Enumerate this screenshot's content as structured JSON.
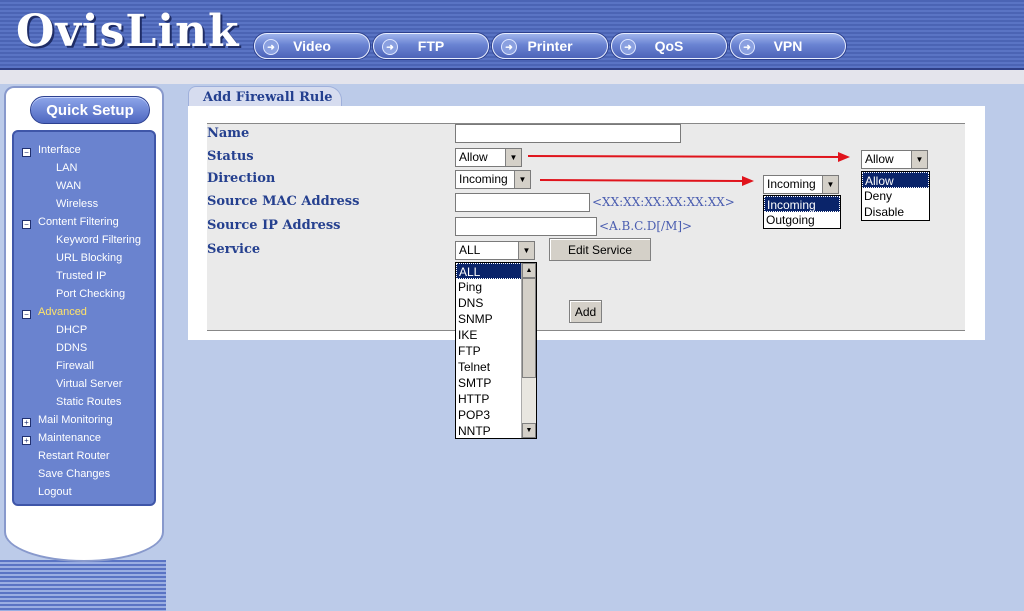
{
  "header": {
    "logo": "OvisLink",
    "nav": [
      {
        "label": "Video"
      },
      {
        "label": "FTP"
      },
      {
        "label": "Printer"
      },
      {
        "label": "QoS"
      },
      {
        "label": "VPN"
      }
    ]
  },
  "sidebar": {
    "quick_setup": "Quick Setup",
    "items": [
      {
        "label": "Interface",
        "toggle": "−"
      },
      {
        "label": "LAN"
      },
      {
        "label": "WAN"
      },
      {
        "label": "Wireless"
      },
      {
        "label": "Content Filtering",
        "toggle": "−"
      },
      {
        "label": "Keyword Filtering"
      },
      {
        "label": "URL Blocking"
      },
      {
        "label": "Trusted IP"
      },
      {
        "label": "Port Checking"
      },
      {
        "label": "Advanced",
        "toggle": "−"
      },
      {
        "label": "DHCP"
      },
      {
        "label": "DDNS"
      },
      {
        "label": "Firewall"
      },
      {
        "label": "Virtual Server"
      },
      {
        "label": "Static Routes"
      },
      {
        "label": "Mail Monitoring",
        "toggle": "+"
      },
      {
        "label": "Maintenance",
        "toggle": "+"
      },
      {
        "label": "Restart Router"
      },
      {
        "label": "Save Changes"
      },
      {
        "label": "Logout"
      }
    ]
  },
  "main": {
    "tab": "Add Firewall Rule",
    "labels": {
      "name": "Name",
      "status": "Status",
      "direction": "Direction",
      "source_mac": "Source MAC Address",
      "source_ip": "Source IP Address",
      "service": "Service"
    },
    "name_value": "",
    "status_value": "Allow",
    "direction_value": "Incoming",
    "mac_value": "",
    "mac_hint": "<XX:XX:XX:XX:XX:XX>",
    "ip_value": "",
    "ip_hint": "<A.B.C.D[/M]>",
    "service_value": "ALL",
    "edit_service": "Edit Service",
    "add": "Add",
    "service_options": [
      "ALL",
      "Ping",
      "DNS",
      "SNMP",
      "IKE",
      "FTP",
      "Telnet",
      "SMTP",
      "HTTP",
      "POP3",
      "NNTP"
    ],
    "status_popup": {
      "value": "Allow",
      "options": [
        "Allow",
        "Deny",
        "Disable"
      ]
    },
    "direction_popup": {
      "value": "Incoming",
      "options": [
        "Incoming",
        "Outgoing"
      ]
    }
  },
  "colors": {
    "header_blue": "#4b64b4",
    "label_blue": "#25408f",
    "selection": "#0a246a",
    "annotation_arrow": "#e0141c"
  },
  "icons": {
    "nav_arrow": "arrow-right-icon",
    "dropdown": "chevron-down-icon",
    "collapse": "minus-box-icon",
    "expand": "plus-box-icon"
  }
}
